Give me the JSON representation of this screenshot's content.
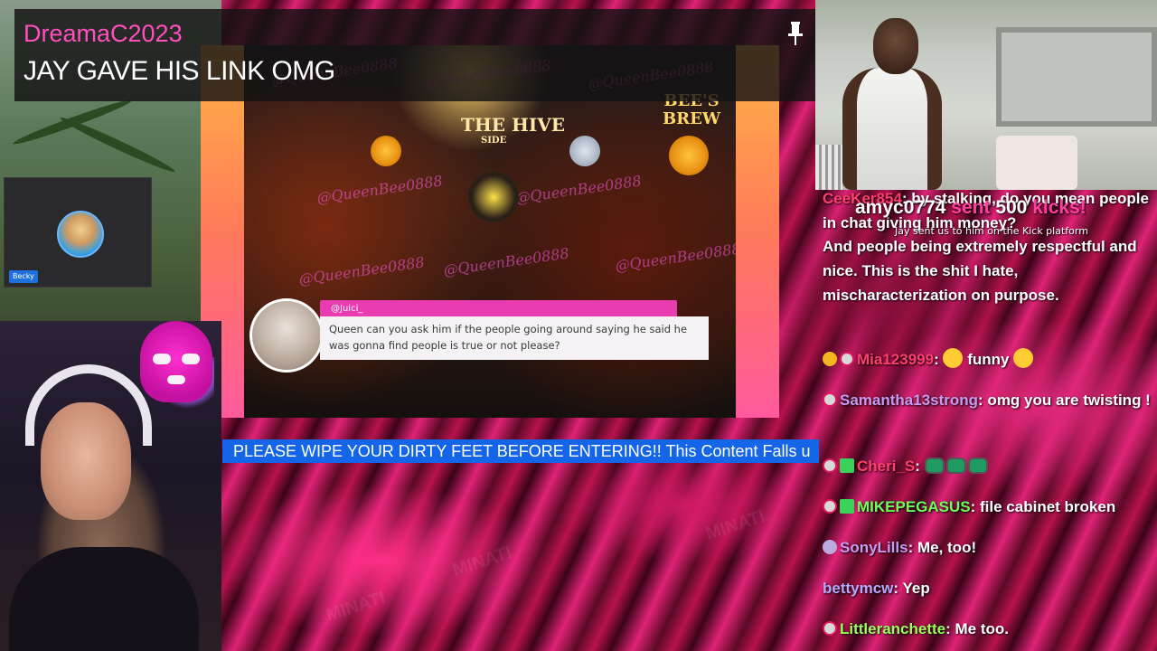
{
  "title_card": {
    "username": "DreamaC2023",
    "message": "JAY GAVE HIS LINK OMG"
  },
  "avatar_tile": {
    "name": "Becky"
  },
  "video": {
    "watermark": "@QueenBee0888",
    "sign_hive": "THE HIVE",
    "sign_hive_sub": "SIDE",
    "sign_brew": "BEE'S\nBREW",
    "comment": {
      "username": "@Juici_",
      "text": "Queen can you ask him if the people going around saying he said he was gonna find people is true or not please?"
    }
  },
  "ticker": {
    "text": "PLEASE WIPE YOUR DIRTY FEET BEFORE ENTERING!! This Content Falls u"
  },
  "kick_alert": {
    "user": "amyc0774",
    "sent": "sent",
    "amount": "500",
    "unit": "kicks!",
    "subtext": "Jay sent us to him on the Kick platform"
  },
  "chat": {
    "messages": [
      {
        "user": "CeeKer854",
        "text": ": by stalking, do you mean people in chat giving him money?",
        "user_color": "#ff3f6c",
        "badges": []
      },
      {
        "user": "",
        "text": "And people being extremely respectful and nice. This is the shit I hate, mischaracterization on purpose.",
        "user_color": "#ffffff",
        "badges": []
      },
      {
        "user": "Mia123999",
        "text": ": funny",
        "user_color": "#ff3f6c",
        "badges": [
          "gold",
          "kick"
        ]
      },
      {
        "user": "Samantha13strong",
        "text": ": omg you are twisting !",
        "user_color": "#c89af0",
        "badges": [
          "kick"
        ]
      },
      {
        "user": "Cheri_S",
        "text": ":",
        "user_color": "#ff3f6c",
        "badges": [
          "kick",
          "gift"
        ]
      },
      {
        "user": "MIKEPEGASUS",
        "text": ": file cabinet broken",
        "user_color": "#6cff5a",
        "badges": [
          "kick",
          "gift"
        ]
      },
      {
        "user": "SonyLills",
        "text": ": Me, too!",
        "user_color": "#c89af0",
        "badges": [
          "moon"
        ]
      },
      {
        "user": "bettymcw",
        "text": ": Yep",
        "user_color": "#b8a8ff",
        "badges": []
      },
      {
        "user": "Littleranchette",
        "text": ": Me too.",
        "user_color": "#9aff5a",
        "badges": [
          "kick"
        ]
      }
    ]
  },
  "overlay_watermark": "MINATI",
  "colors": {
    "username_pink": "#ff4fbf",
    "ticker_blue": "#1565e8",
    "comment_pink": "#e83cb0"
  }
}
